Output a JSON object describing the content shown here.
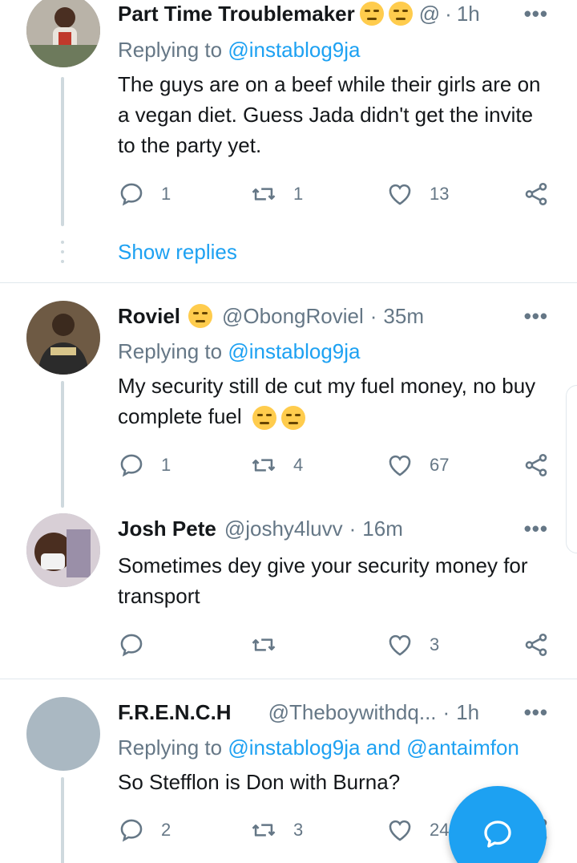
{
  "tweets": [
    {
      "name": "Part Time Troublemaker",
      "handle": "@",
      "time": "1h",
      "replying_label": "Replying to",
      "replying_to": "@instablog9ja",
      "text": "The guys are on a beef while their girls are on a vegan diet. Guess Jada didn't get the invite to the party yet.",
      "replies": "1",
      "retweets": "1",
      "likes": "13",
      "show_replies": "Show replies"
    },
    {
      "name": "Roviel",
      "handle": "@ObongRoviel",
      "time": "35m",
      "replying_label": "Replying to",
      "replying_to": "@instablog9ja",
      "text": "My security still de cut my fuel money, no buy complete fuel",
      "replies": "1",
      "retweets": "4",
      "likes": "67"
    },
    {
      "name": "Josh Pete",
      "handle": "@joshy4luvv",
      "time": "16m",
      "text": "Sometimes dey give your security money for transport",
      "replies": "",
      "retweets": "",
      "likes": "3"
    },
    {
      "name": "F.R.E.N.C.H",
      "handle": "@Theboywithdq...",
      "time": "1h",
      "replying_label": "Replying to",
      "replying_to": "@instablog9ja and @antaimfon",
      "text": "So Stefflon is Don with Burna?",
      "replies": "2",
      "retweets": "3",
      "likes": "24"
    }
  ],
  "separator": "·",
  "more_icon": "more-horizontal-icon",
  "colors": {
    "accent": "#1da1f2",
    "muted": "#657786",
    "text": "#14171a"
  }
}
